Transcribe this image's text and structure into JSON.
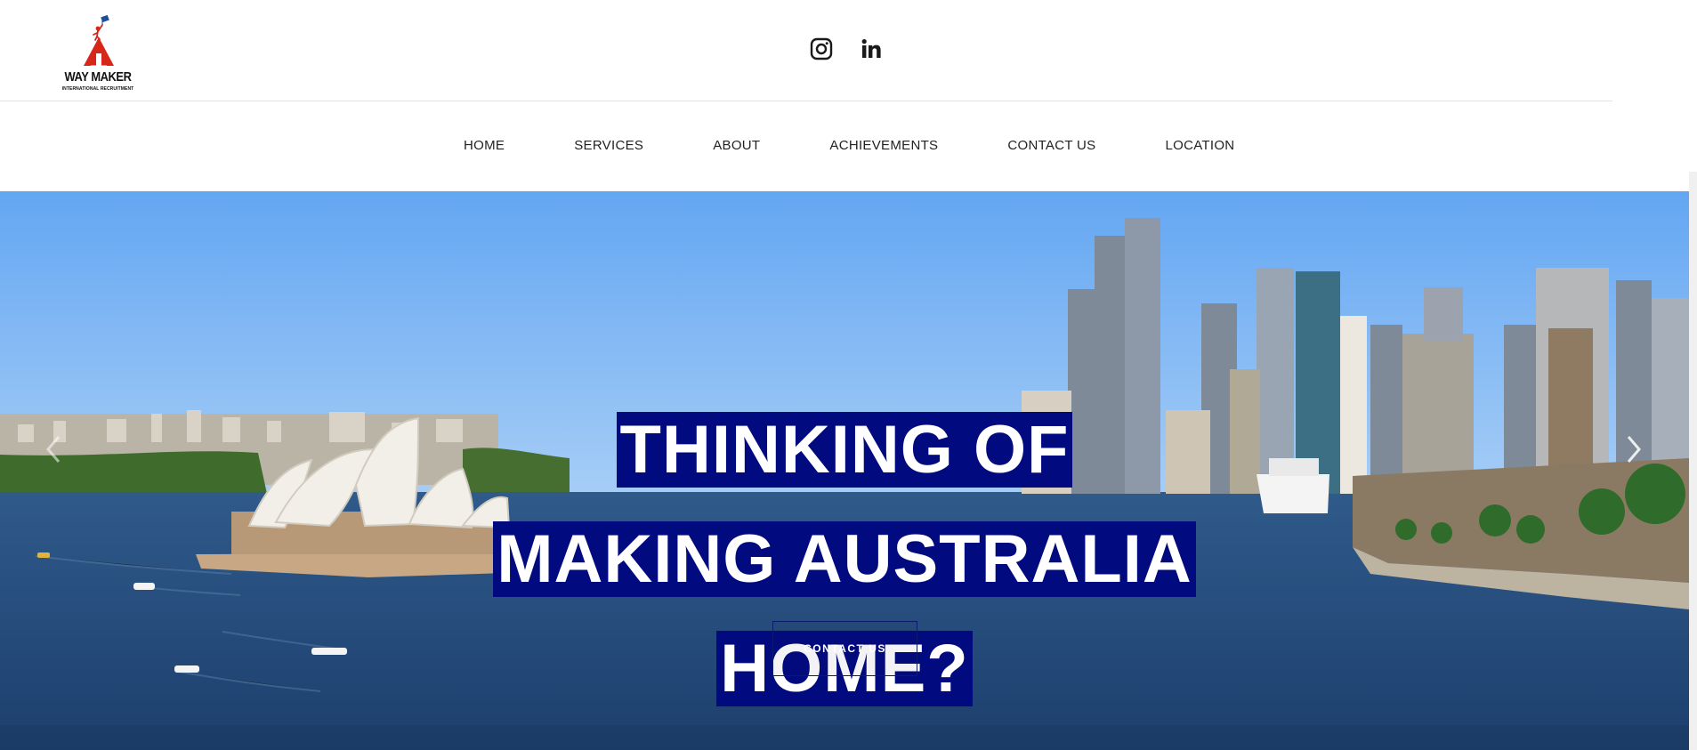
{
  "logo": {
    "title": "WAY MAKER",
    "subtitle": "INTERNATIONAL RECRUITMENT"
  },
  "social": {
    "icons": [
      "instagram-icon",
      "linkedin-icon"
    ]
  },
  "nav": {
    "items": [
      "HOME",
      "SERVICES",
      "ABOUT",
      "ACHIEVEMENTS",
      "CONTACT US",
      "LOCATION"
    ]
  },
  "hero": {
    "headline": "THINKING OF MAKING AUSTRALIA HOME?",
    "cta_label": "CONTACT US",
    "prev_icon": "chevron-left-icon",
    "next_icon": "chevron-right-icon"
  },
  "colors": {
    "headline_bg": "#020a80",
    "logo_red": "#d62718",
    "logo_blue": "#1d4f9c"
  }
}
